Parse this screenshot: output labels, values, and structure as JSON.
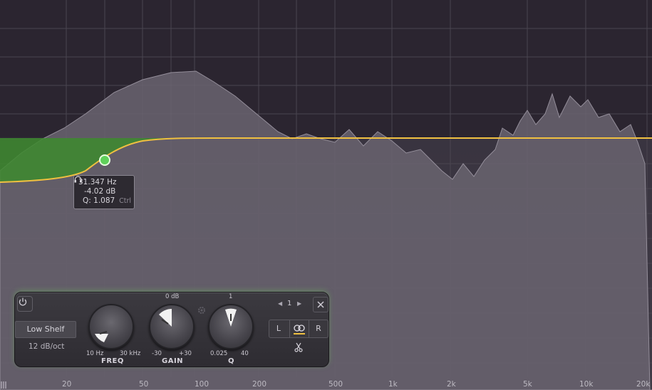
{
  "tooltip": {
    "freq": "31.347 Hz",
    "gain": "-4.02 dB",
    "q": "Q: 1.087",
    "mod": "Ctrl",
    "icon": "headphones-icon"
  },
  "band": {
    "shape": "Low Shelf",
    "slope": "12 dB/oct",
    "number": "1",
    "freq": {
      "name": "FREQ",
      "min": "10 Hz",
      "max": "30 kHz",
      "value_hz": 31.347
    },
    "gain": {
      "name": "GAIN",
      "center": "0 dB",
      "min": "-30",
      "max": "+30",
      "value_db": -4.02
    },
    "q": {
      "name": "Q",
      "center": "1",
      "min": "0.025",
      "max": "40",
      "value": 1.087
    },
    "stereo": {
      "left": "L",
      "right": "R",
      "link_icon": "stereo-link-icon"
    }
  },
  "freq_axis": [
    "20",
    "50",
    "100",
    "200",
    "500",
    "1k",
    "2k",
    "5k",
    "10k",
    "20k"
  ],
  "colors": {
    "curve": "#f0c040",
    "band_fill": "#3d8a2e",
    "node": "#5fd05a",
    "spectrum": "#6a6470"
  }
}
